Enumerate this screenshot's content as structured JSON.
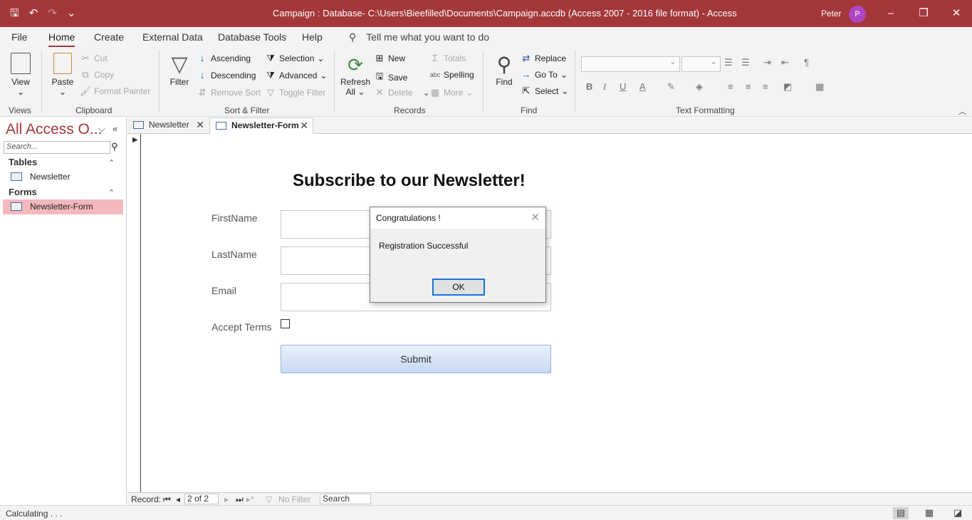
{
  "titlebar": {
    "title": "Campaign : Database- C:\\Users\\Bieefilled\\Documents\\Campaign.accdb (Access 2007 - 2016 file format)  -  Access",
    "user_name": "Peter",
    "avatar_initial": "P",
    "accent_color": "#a4373a"
  },
  "menu": {
    "tabs": [
      "File",
      "Home",
      "Create",
      "External Data",
      "Database Tools",
      "Help"
    ],
    "active_tab": "Home",
    "tell_me": "Tell me what you want to do"
  },
  "ribbon": {
    "views": {
      "view_label": "View",
      "group": "Views"
    },
    "clipboard": {
      "paste": "Paste",
      "cut": "Cut",
      "copy": "Copy",
      "format_painter": "Format Painter",
      "group": "Clipboard"
    },
    "sort_filter": {
      "filter": "Filter",
      "ascending": "Ascending",
      "descending": "Descending",
      "remove_sort": "Remove Sort",
      "selection": "Selection",
      "advanced": "Advanced",
      "toggle_filter": "Toggle Filter",
      "group": "Sort & Filter"
    },
    "records": {
      "refresh_all": "Refresh",
      "refresh_all_2": "All",
      "new": "New",
      "save": "Save",
      "delete": "Delete",
      "totals": "Totals",
      "spelling": "Spelling",
      "more": "More",
      "group": "Records"
    },
    "find": {
      "find": "Find",
      "replace": "Replace",
      "go_to": "Go To",
      "select": "Select",
      "group": "Find"
    },
    "text_formatting": {
      "group": "Text Formatting"
    }
  },
  "nav": {
    "title": "All Access O...",
    "search_placeholder": "Search...",
    "sections": [
      {
        "label": "Tables",
        "items": [
          "Newsletter"
        ]
      },
      {
        "label": "Forms",
        "items": [
          "Newsletter-Form"
        ]
      }
    ],
    "selected_item": "Newsletter-Form"
  },
  "doc_tabs": [
    {
      "label": "Newsletter",
      "active": false
    },
    {
      "label": "Newsletter-Form",
      "active": true
    }
  ],
  "form": {
    "title": "Subscribe to our Newsletter!",
    "fields": [
      {
        "label": "FirstName",
        "value": ""
      },
      {
        "label": "LastName",
        "value": ""
      },
      {
        "label": "Email",
        "value": ""
      }
    ],
    "checkbox_label": "Accept Terms",
    "checkbox_checked": false,
    "submit_label": "Submit"
  },
  "record_nav": {
    "label": "Record:",
    "position": "2 of 2",
    "filter_status": "No Filter",
    "search_placeholder": "Search"
  },
  "status": {
    "text": "Calculating . . ."
  },
  "dialog": {
    "title": "Congratulations !",
    "message": "Registration Successful",
    "ok_label": "OK"
  }
}
